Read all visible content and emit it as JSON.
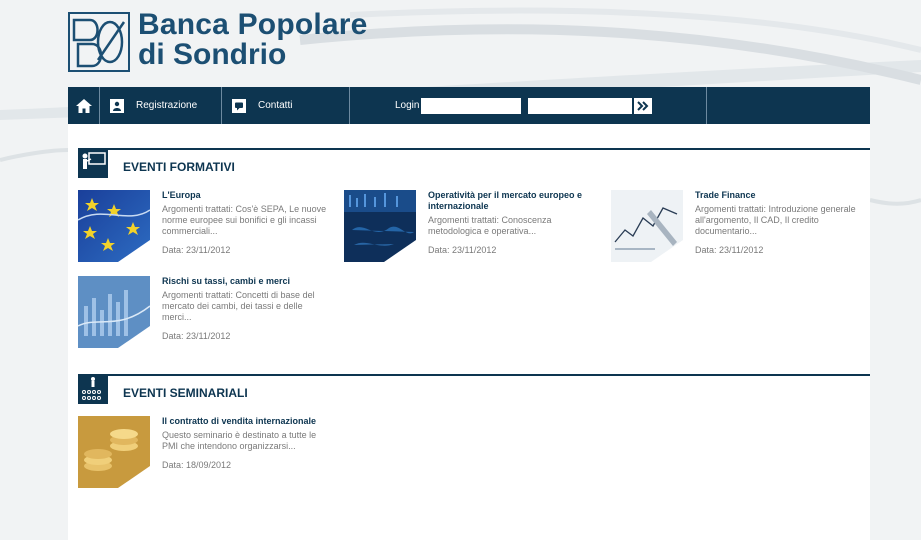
{
  "brand": {
    "line1": "Banca Popolare",
    "line2": "di Sondrio",
    "color": "#1c4f73"
  },
  "nav": {
    "home_icon": "home-icon",
    "registrazione": "Registrazione",
    "contatti": "Contatti",
    "login_label": "Login",
    "username_value": "",
    "password_value": "",
    "go_icon": "double-chevron-right-icon"
  },
  "sections": {
    "formativi": {
      "title": "EVENTI FORMATIVI",
      "icon": "teacher-board-icon",
      "events": [
        {
          "title": "L'Europa",
          "desc": "Argomenti trattati: Cos'è SEPA, Le nuove norme europee sui bonifici e gli incassi commerciali...",
          "date": "Data: 23/11/2012",
          "thumb": "eu-flag-image"
        },
        {
          "title": "Operatività per il mercato europeo e internazionale",
          "desc": "Argomenti trattati: Conoscenza metodologica e operativa...",
          "date": "Data: 23/11/2012",
          "thumb": "world-map-image"
        },
        {
          "title": "Trade Finance",
          "desc": "Argomenti trattati: Introduzione generale all'argomento, Il CAD, Il credito documentario...",
          "date": "Data: 23/11/2012",
          "thumb": "chart-pen-image"
        },
        {
          "title": "Rischi su tassi, cambi e merci",
          "desc": "Argomenti trattati: Concetti di base del mercato dei cambi, dei tassi e delle merci...",
          "date": "Data: 23/11/2012",
          "thumb": "finance-chart-image"
        }
      ]
    },
    "seminariali": {
      "title": "EVENTI SEMINARIALI",
      "icon": "audience-icon",
      "events": [
        {
          "title": "Il contratto di vendita internazionale",
          "desc": "Questo seminario è destinato a tutte le PMI che intendono organizzarsi...",
          "date": "Data: 18/09/2012",
          "thumb": "coins-image"
        }
      ]
    }
  },
  "colors": {
    "navy": "#0d3550",
    "gray_text": "#7a7a7a",
    "page_bg": "#f1f3f4"
  }
}
